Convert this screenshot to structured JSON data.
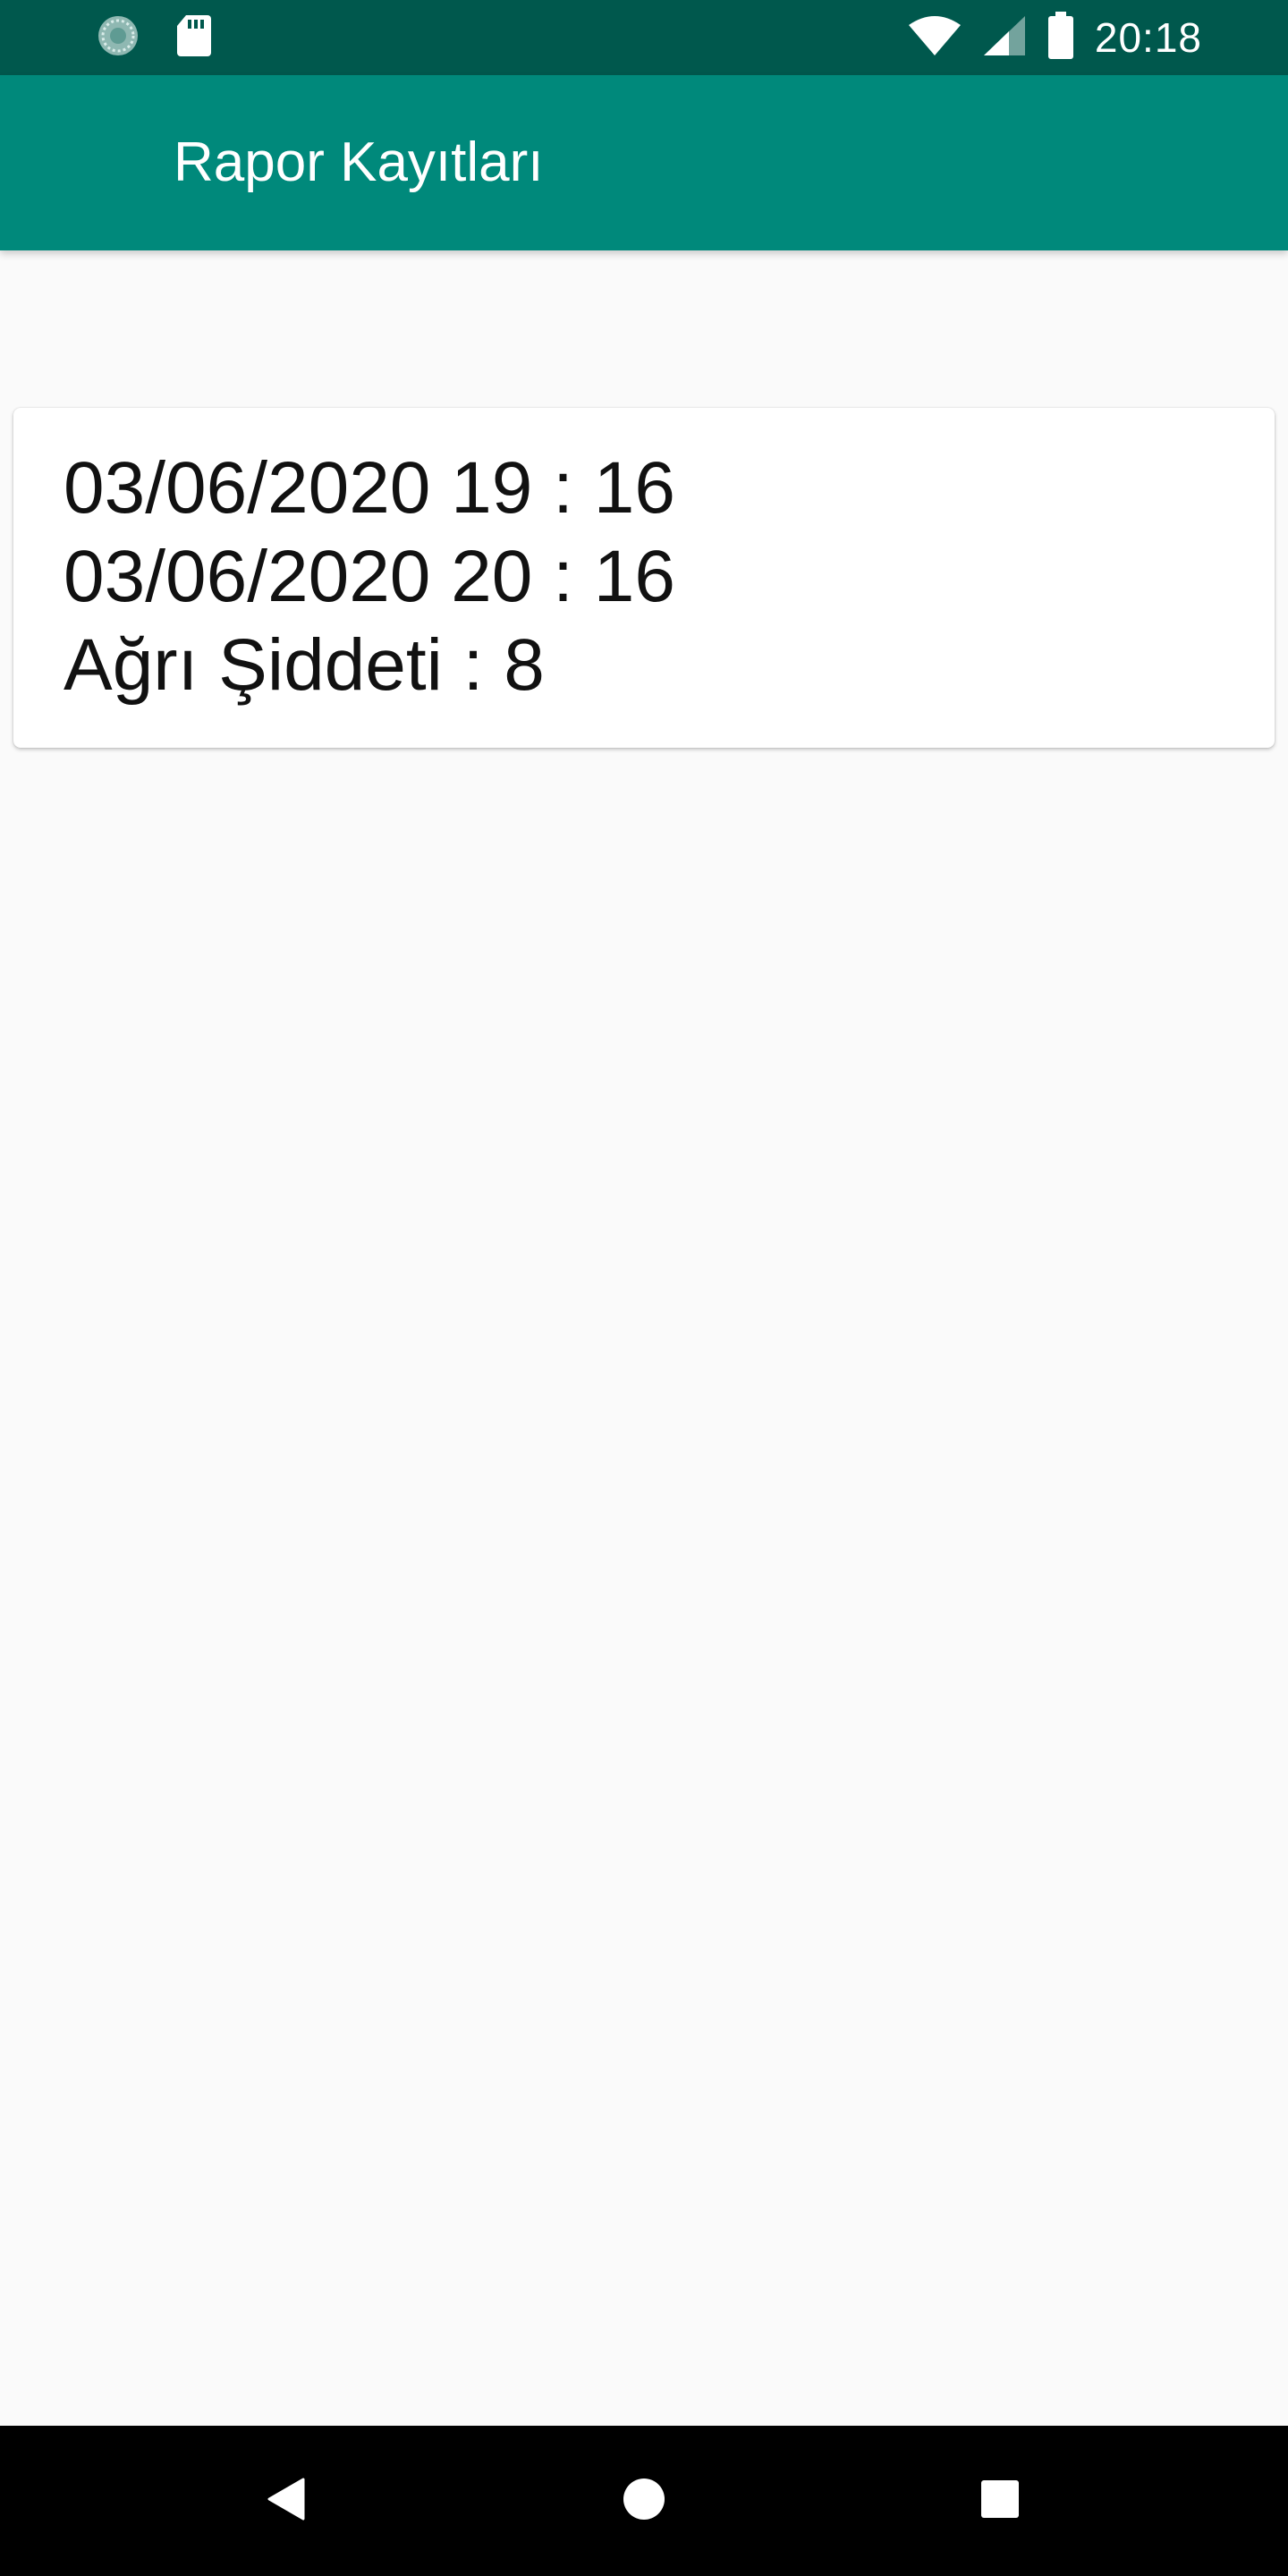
{
  "status_bar": {
    "time": "20:18",
    "icons": [
      "sync-icon",
      "sd-card-icon",
      "wifi-icon",
      "signal-icon",
      "battery-icon"
    ]
  },
  "app_bar": {
    "title": "Rapor Kayıtları"
  },
  "records": [
    {
      "start": "03/06/2020 19 : 16",
      "end": "03/06/2020 20 : 16",
      "severity": "Ağrı Şiddeti : 8"
    }
  ],
  "nav_bar": {
    "buttons": [
      "back-icon",
      "home-icon",
      "recents-icon"
    ]
  },
  "colors": {
    "status_bar": "#00584d",
    "app_bar": "#00897b",
    "background": "#fafafa",
    "card": "#ffffff",
    "nav_bar": "#000000"
  }
}
